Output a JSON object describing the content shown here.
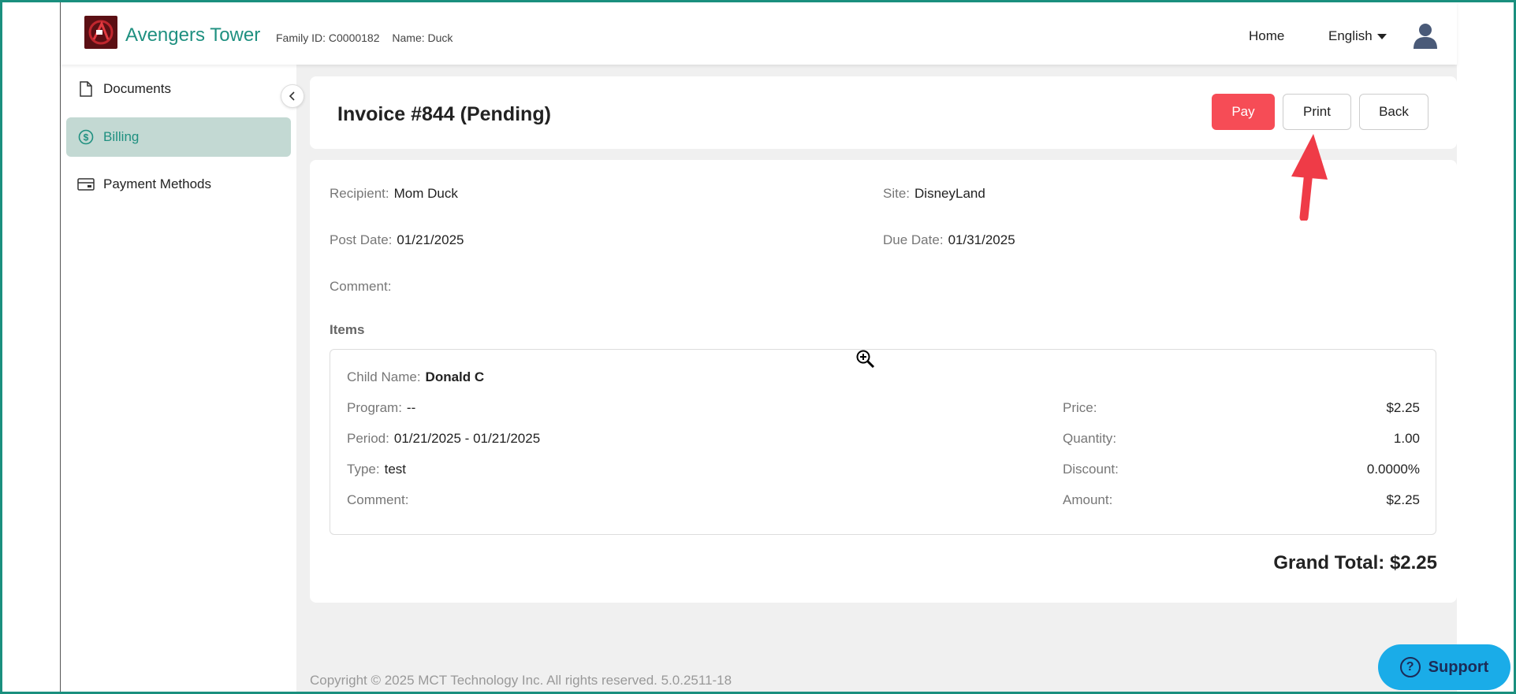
{
  "header": {
    "app_title": "Avengers Tower",
    "family_id": "Family ID: C0000182",
    "name": "Name: Duck",
    "home_label": "Home",
    "language_label": "English"
  },
  "sidebar": {
    "items": [
      {
        "label": "Documents",
        "icon": "document-icon"
      },
      {
        "label": "Billing",
        "icon": "dollar-circle-icon",
        "active": true
      },
      {
        "label": "Payment Methods",
        "icon": "credit-card-icon"
      }
    ]
  },
  "invoice": {
    "title": "Invoice #844 (Pending)",
    "buttons": {
      "pay": "Pay",
      "print": "Print",
      "back": "Back"
    },
    "fields": {
      "recipient_label": "Recipient",
      "recipient_value": "Mom Duck",
      "site_label": "Site",
      "site_value": "DisneyLand",
      "post_date_label": "Post Date",
      "post_date_value": "01/21/2025",
      "due_date_label": "Due Date",
      "due_date_value": "01/31/2025",
      "comment_label": "Comment",
      "comment_value": ""
    },
    "items_label": "Items",
    "item": {
      "child_name_label": "Child Name",
      "child_name_value": "Donald C",
      "program_label": "Program",
      "program_value": "--",
      "period_label": "Period",
      "period_value": "01/21/2025 - 01/21/2025",
      "type_label": "Type",
      "type_value": "test",
      "comment_label": "Comment",
      "comment_value": "",
      "price_label": "Price",
      "price_value": "$2.25",
      "quantity_label": "Quantity",
      "quantity_value": "1.00",
      "discount_label": "Discount",
      "discount_value": "0.0000%",
      "amount_label": "Amount",
      "amount_value": "$2.25"
    },
    "grand_total": "Grand Total: $2.25"
  },
  "footer": {
    "copyright": "Copyright © 2025 MCT Technology Inc. All rights reserved. 5.0.2511-18"
  },
  "support": {
    "label": "Support"
  },
  "colors": {
    "brand_teal": "#1f9080",
    "pay_red": "#f64c56",
    "support_blue": "#1aace8",
    "active_bg": "#c3d9d3",
    "annotation_arrow": "#ef3b47"
  }
}
